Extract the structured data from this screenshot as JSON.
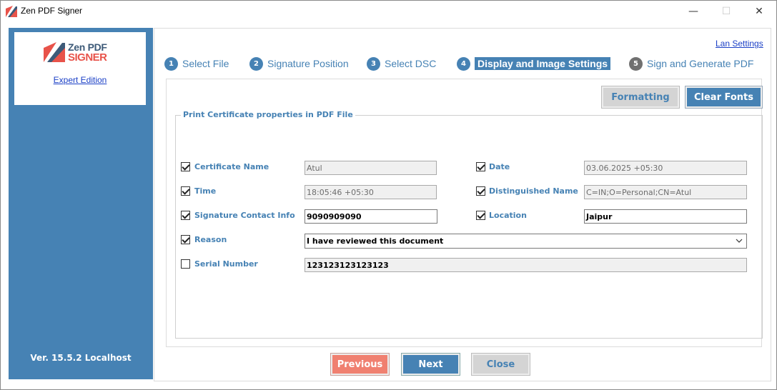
{
  "window": {
    "title": "Zen PDF Signer",
    "min_glyph": "—",
    "max_glyph": "☐",
    "close_glyph": "✕"
  },
  "sidebar": {
    "logo": {
      "line1": "Zen PDF",
      "line2": "SIGNER"
    },
    "edition_link": "Expert Edition",
    "version": "Ver. 15.5.2 Localhost"
  },
  "header": {
    "lan_settings": "Lan Settings"
  },
  "steps": [
    {
      "num": "1",
      "label": "Select File"
    },
    {
      "num": "2",
      "label": "Signature Position"
    },
    {
      "num": "3",
      "label": "Select DSC"
    },
    {
      "num": "4",
      "label": "Display and Image Settings",
      "active": true
    },
    {
      "num": "5",
      "label": "Sign and Generate PDF"
    }
  ],
  "toolbar": {
    "formatting": "Formatting",
    "clear_fonts": "Clear Fonts"
  },
  "group": {
    "title": "Print Certificate properties in PDF File",
    "fields": {
      "certificate_name": {
        "label": "Certificate Name",
        "value": "Atul",
        "checked": true
      },
      "date": {
        "label": "Date",
        "value": "03.06.2025 +05:30",
        "checked": true
      },
      "time": {
        "label": "Time",
        "value": "18:05:46 +05:30",
        "checked": true
      },
      "distinguished_name": {
        "label": "Distinguished Name",
        "value": "C=IN;O=Personal;CN=Atul",
        "checked": true
      },
      "signature_contact_info": {
        "label": "Signature Contact Info",
        "value": "9090909090",
        "checked": true
      },
      "location": {
        "label": "Location",
        "value": "Jaipur",
        "checked": true
      },
      "reason": {
        "label": "Reason",
        "value": "I have reviewed this document",
        "checked": true
      },
      "serial_number": {
        "label": "Serial Number",
        "value": "123123123123123",
        "checked": false
      }
    }
  },
  "footer": {
    "previous": "Previous",
    "next": "Next",
    "close": "Close"
  },
  "colors": {
    "accent": "#4682b4",
    "danger": "#f08070",
    "logo_red": "#e8534a",
    "logo_navy": "#3d5a78"
  }
}
